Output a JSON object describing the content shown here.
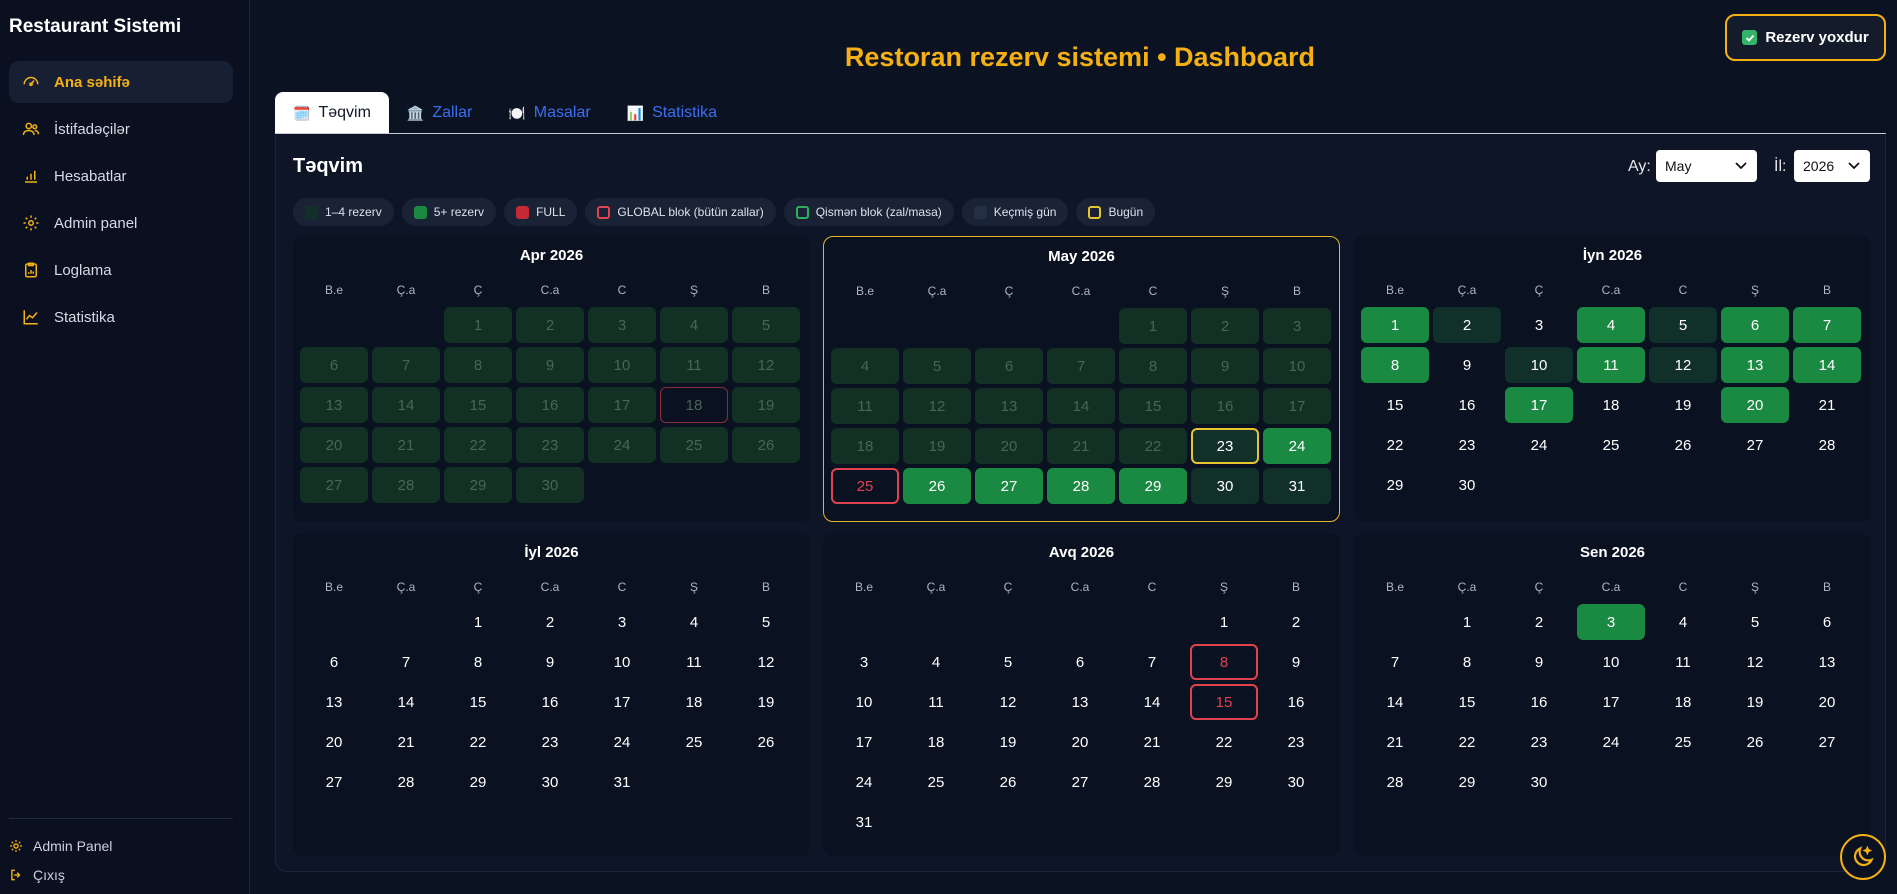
{
  "app": {
    "brand": "Restaurant Sistemi",
    "title": "Restoran rezerv sistemi • Dashboard",
    "status": "Rezerv yoxdur"
  },
  "sidebar": {
    "items": [
      {
        "label": "Ana səhifə",
        "icon": "gauge-icon"
      },
      {
        "label": "İstifadəçilər",
        "icon": "users-icon"
      },
      {
        "label": "Hesabatlar",
        "icon": "bar-chart-icon"
      },
      {
        "label": "Admin panel",
        "icon": "gear-icon"
      },
      {
        "label": "Loglama",
        "icon": "clipboard-icon"
      },
      {
        "label": "Statistika",
        "icon": "trend-icon"
      }
    ],
    "footer": {
      "admin": "Admin Panel",
      "logout": "Çıxış"
    }
  },
  "tabs": [
    {
      "label": "Təqvim",
      "icon": "🗓️"
    },
    {
      "label": "Zallar",
      "icon": "🏛️"
    },
    {
      "label": "Masalar",
      "icon": "🍽️"
    },
    {
      "label": "Statistika",
      "icon": "📊"
    }
  ],
  "calendar": {
    "title": "Təqvim",
    "month_label": "Ay:",
    "month_value": "May",
    "year_label": "İl:",
    "year_value": "2026",
    "legend": [
      {
        "label": "1–4 rezerv",
        "color": "#12302a",
        "border": ""
      },
      {
        "label": "5+ rezerv",
        "color": "#1a8a42",
        "border": ""
      },
      {
        "label": "FULL",
        "color": "#c42a33",
        "border": ""
      },
      {
        "label": "GLOBAL blok (bütün zallar)",
        "color": "#1a2336",
        "border": "#e0434f"
      },
      {
        "label": "Qismən blok (zal/masa)",
        "color": "#1a2336",
        "border": "#2fae5e"
      },
      {
        "label": "Keçmiş gün",
        "color": "#242e44",
        "border": ""
      },
      {
        "label": "Bugün",
        "color": "#1a2336",
        "border": "#e7c52c"
      }
    ],
    "weekdays": [
      "B.e",
      "Ç.a",
      "Ç",
      "C.a",
      "C",
      "Ş",
      "B"
    ],
    "months": [
      {
        "name": "Apr 2026",
        "offset": 2,
        "days": 30,
        "current": false,
        "past_until": 30,
        "t1": [
          1,
          2,
          3,
          4,
          5,
          6,
          7,
          8,
          9,
          10,
          11,
          12,
          13,
          14,
          15,
          16,
          17,
          19,
          20,
          21,
          22,
          23,
          24,
          25,
          26,
          27,
          28,
          29,
          30
        ],
        "t2": [],
        "today": 0,
        "blocked": [],
        "blocked_past": [
          18
        ]
      },
      {
        "name": "May 2026",
        "offset": 4,
        "days": 31,
        "current": true,
        "past_until": 22,
        "t1": [
          1,
          2,
          3,
          4,
          5,
          6,
          7,
          8,
          9,
          10,
          11,
          12,
          13,
          14,
          15,
          16,
          17,
          18,
          19,
          20,
          21,
          22,
          23,
          30,
          31
        ],
        "t2": [
          24,
          26,
          27,
          28,
          29
        ],
        "today": 23,
        "blocked": [
          25
        ],
        "blocked_past": []
      },
      {
        "name": "İyn 2026",
        "offset": 0,
        "days": 30,
        "current": false,
        "past_until": 0,
        "t1": [
          2,
          5,
          10,
          12
        ],
        "t2": [
          1,
          4,
          6,
          7,
          8,
          11,
          13,
          14,
          17,
          20
        ],
        "today": 0,
        "blocked": [],
        "blocked_past": []
      },
      {
        "name": "İyl 2026",
        "offset": 2,
        "days": 31,
        "current": false,
        "past_until": 0,
        "t1": [],
        "t2": [],
        "today": 0,
        "blocked": [],
        "blocked_past": []
      },
      {
        "name": "Avq 2026",
        "offset": 5,
        "days": 31,
        "current": false,
        "past_until": 0,
        "t1": [],
        "t2": [],
        "today": 0,
        "blocked": [
          8,
          15
        ],
        "blocked_past": []
      },
      {
        "name": "Sen 2026",
        "offset": 1,
        "days": 30,
        "current": false,
        "past_until": 0,
        "t1": [],
        "t2": [
          3
        ],
        "today": 0,
        "blocked": [],
        "blocked_past": []
      }
    ]
  }
}
